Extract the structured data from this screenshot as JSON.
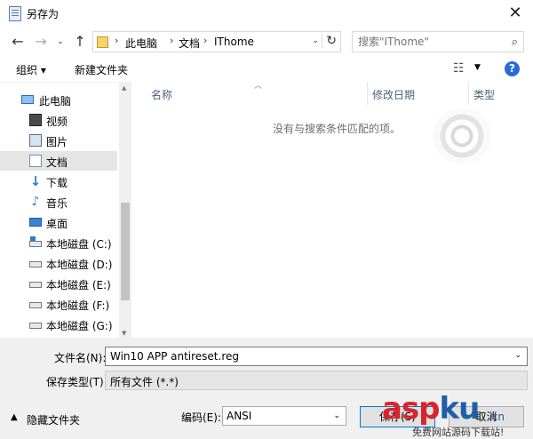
{
  "window": {
    "title": "另存为",
    "close_glyph": "✕"
  },
  "address": {
    "path": [
      "此电脑",
      "文档",
      "IThome"
    ],
    "search_placeholder": "搜索\"IThome\""
  },
  "toolbar": {
    "organize": "组织 ▾",
    "new_folder": "新建文件夹",
    "help": "?"
  },
  "sidebar": {
    "items": [
      {
        "label": "此电脑",
        "icon": "computer-icon"
      },
      {
        "label": "视频",
        "icon": "video-icon"
      },
      {
        "label": "图片",
        "icon": "pictures-icon"
      },
      {
        "label": "文档",
        "icon": "documents-icon",
        "selected": true
      },
      {
        "label": "下载",
        "icon": "download-icon"
      },
      {
        "label": "音乐",
        "icon": "music-icon"
      },
      {
        "label": "桌面",
        "icon": "desktop-icon"
      },
      {
        "label": "本地磁盘 (C:)",
        "icon": "system-drive-icon"
      },
      {
        "label": "本地磁盘 (D:)",
        "icon": "drive-icon"
      },
      {
        "label": "本地磁盘 (E:)",
        "icon": "drive-icon"
      },
      {
        "label": "本地磁盘 (F:)",
        "icon": "drive-icon"
      },
      {
        "label": "本地磁盘 (G:)",
        "icon": "drive-icon"
      }
    ]
  },
  "file_list": {
    "columns": [
      "名称",
      "修改日期",
      "类型"
    ],
    "empty_message": "没有与搜索条件匹配的项。"
  },
  "form": {
    "filename_label": "文件名(N):",
    "filename_value": "Win10 APP antireset.reg",
    "filetype_label": "保存类型(T):",
    "filetype_value": "所有文件 (*.*)",
    "hide_folders": "隐藏文件夹",
    "encoding_label": "编码(E):",
    "encoding_value": "ANSI",
    "save_button": "保存(S)",
    "cancel_button": "取消"
  },
  "watermark": {
    "asp": "asp",
    "ku": "ku",
    "cn": ".cn",
    "sub": "免费网站源码下载站!"
  }
}
